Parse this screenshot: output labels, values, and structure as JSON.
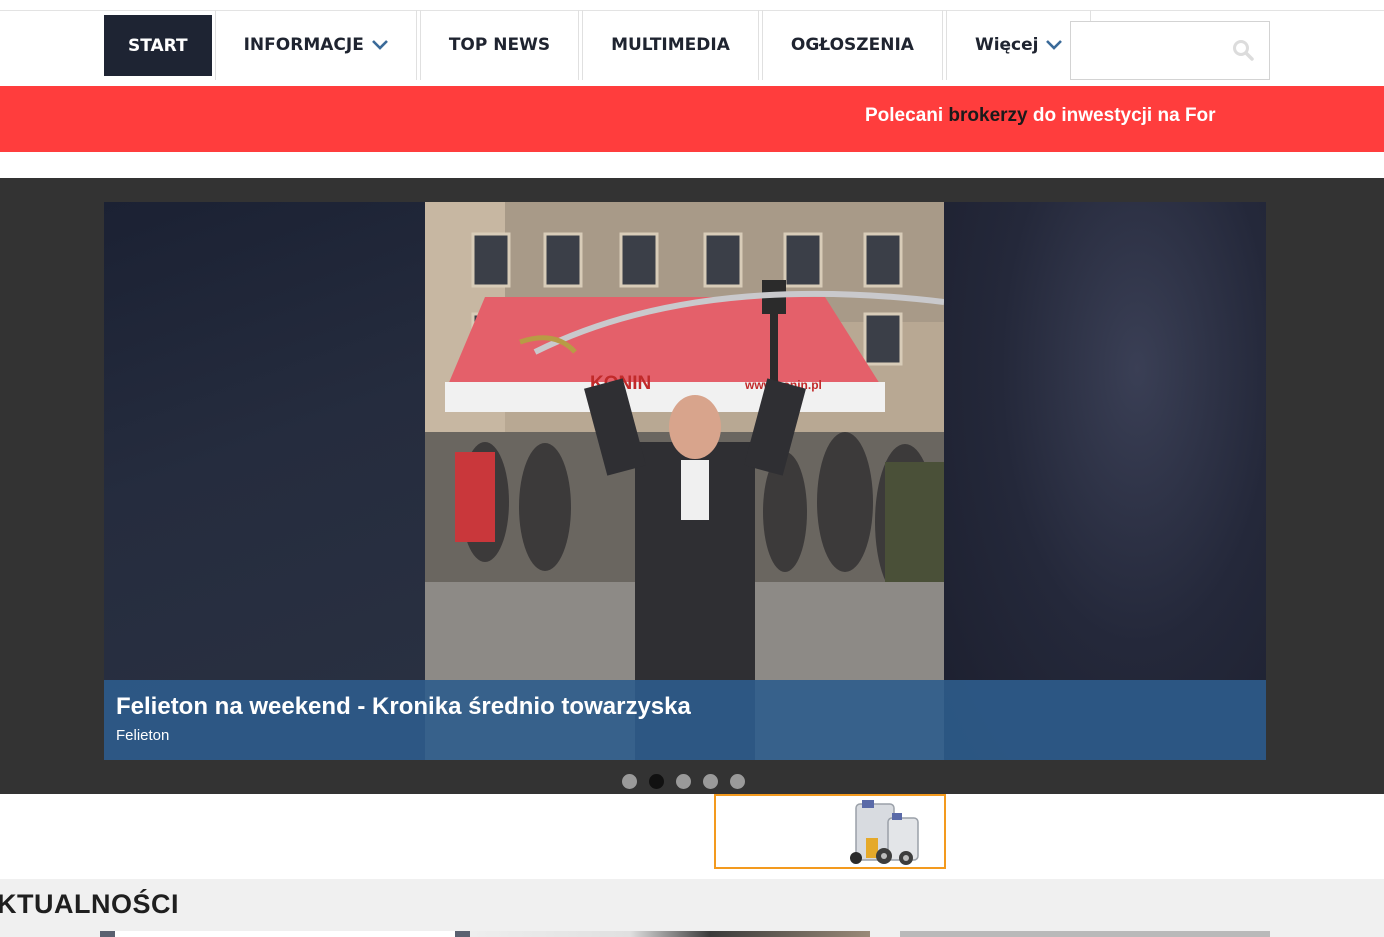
{
  "nav": {
    "items": [
      {
        "label": "START",
        "active": true,
        "dropdown": false
      },
      {
        "label": "INFORMACJE",
        "active": false,
        "dropdown": true
      },
      {
        "label": "TOP NEWS",
        "active": false,
        "dropdown": false
      },
      {
        "label": "MULTIMEDIA",
        "active": false,
        "dropdown": false
      },
      {
        "label": "OGŁOSZENIA",
        "active": false,
        "dropdown": false
      },
      {
        "label": "Więcej",
        "active": false,
        "dropdown": true
      }
    ],
    "search_placeholder": "",
    "search_value": ""
  },
  "ticker": {
    "before": "Polecani ",
    "highlight": "brokerzy",
    "after": " do inwestycji na For"
  },
  "slider": {
    "title": "Felieton na weekend - Kronika średnio towarzyska",
    "category": "Felieton",
    "dot_count": 5,
    "active_dot": 2,
    "photo_sign": "KONIN",
    "photo_sign2": "www.konin.pl"
  },
  "section": {
    "title": "KTUALNOŚCI"
  },
  "colors": {
    "nav_active_bg": "#1e2433",
    "ticker_bg": "#ff3d3d",
    "caption_bg": "#2e5c8c",
    "ad_border": "#f39a1e"
  },
  "icons": [
    "chevron-down-icon",
    "search-icon"
  ]
}
